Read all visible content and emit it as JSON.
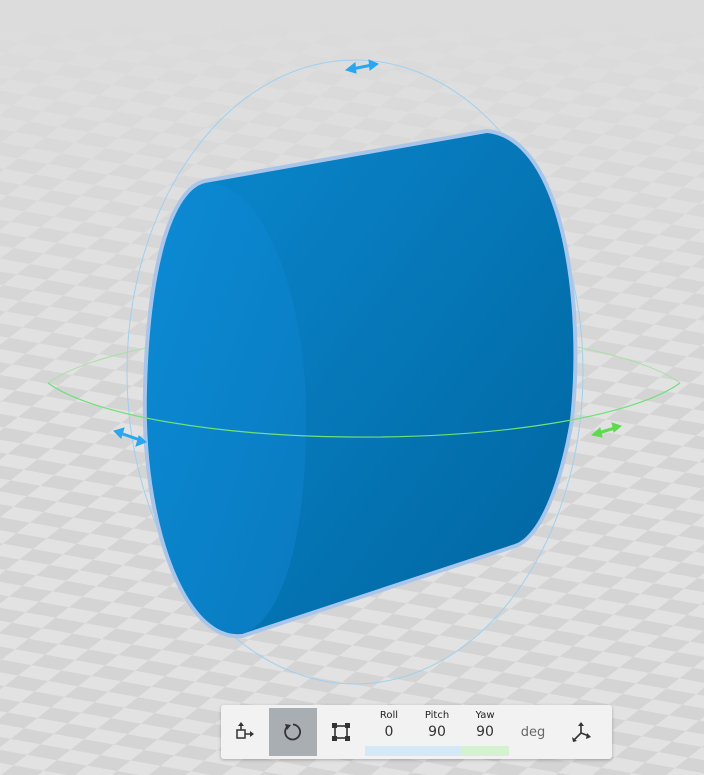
{
  "toolbar": {
    "tools": [
      {
        "name": "move-tool",
        "icon": "move-icon",
        "active": false
      },
      {
        "name": "rotate-tool",
        "icon": "rotate-icon",
        "active": true
      },
      {
        "name": "scale-tool",
        "icon": "scale-icon",
        "active": false
      }
    ],
    "roll_label": "Roll",
    "roll_value": "0",
    "pitch_label": "Pitch",
    "pitch_value": "90",
    "yaw_label": "Yaw",
    "yaw_value": "90",
    "unit": "deg",
    "transform_icon": "axes-icon"
  },
  "colors": {
    "model": "#0a7fc4",
    "model_dark": "#006aa8",
    "model_end": "#0a84ce",
    "outline": "#a9c6ea",
    "gizmo_blue": "#2aa6f0",
    "gizmo_green": "#6fe060",
    "active_tool": "#a9aeb3",
    "roll_bar": "#d5e8f5",
    "pitch_bar": "#d5e8f5",
    "yaw_bar": "#d4f2cf"
  }
}
